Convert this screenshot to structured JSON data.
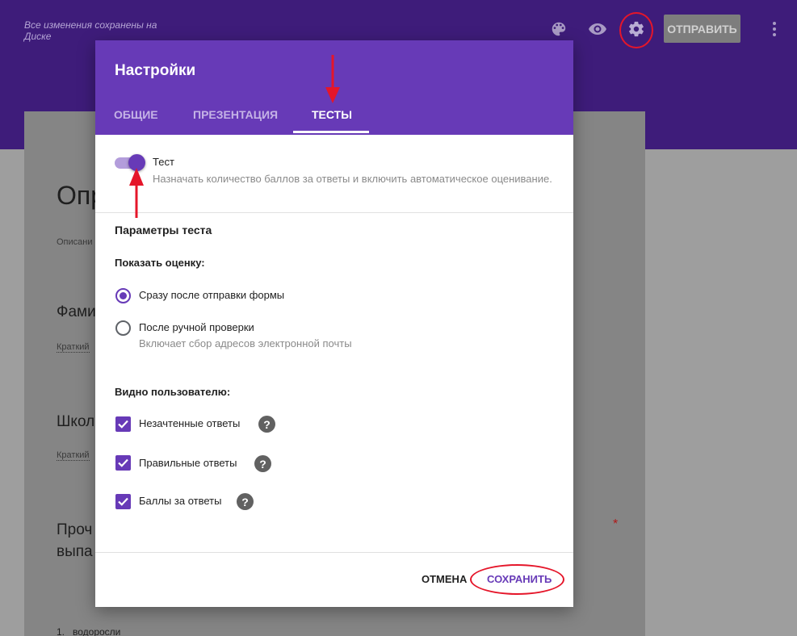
{
  "header": {
    "saved_status": "Все изменения сохранены на Диске",
    "send_label": "ОТПРАВИТЬ",
    "icons": [
      "palette-icon",
      "eye-icon",
      "gear-icon",
      "more-vert-icon"
    ]
  },
  "background_form": {
    "title_fragment": "Опр",
    "description_fragment": "Описани",
    "question1_fragment": "Фами",
    "short_answer_1": "Краткий",
    "question2_fragment": "Школ",
    "short_answer_2": "Краткий",
    "question3_line1": "Проч",
    "question3_line2": "выпа",
    "required_mark": "*",
    "list_item": "1.   водоросли"
  },
  "dialog": {
    "title": "Настройки",
    "tabs": [
      {
        "label": "ОБЩИЕ",
        "active": false
      },
      {
        "label": "ПРЕЗЕНТАЦИЯ",
        "active": false
      },
      {
        "label": "ТЕСТЫ",
        "active": true
      }
    ],
    "quiz_toggle": {
      "label": "Тест",
      "description": "Назначать количество баллов за ответы и включить автоматическое оценивание.",
      "on": true
    },
    "section_title": "Параметры теста",
    "release_grade": {
      "label": "Показать оценку:",
      "options": [
        {
          "label": "Сразу после отправки формы",
          "sub": "",
          "selected": true
        },
        {
          "label": "После ручной проверки",
          "sub": "Включает сбор адресов электронной почты",
          "selected": false
        }
      ]
    },
    "respondent_can_see": {
      "label": "Видно пользователю:",
      "options": [
        {
          "label": "Незачтенные ответы",
          "checked": true
        },
        {
          "label": "Правильные ответы",
          "checked": true
        },
        {
          "label": "Баллы за ответы",
          "checked": true
        }
      ]
    },
    "buttons": {
      "cancel": "ОТМЕНА",
      "save": "СОХРАНИТЬ"
    }
  },
  "colors": {
    "accent": "#673ab7",
    "annotation_red": "#e5162a"
  }
}
